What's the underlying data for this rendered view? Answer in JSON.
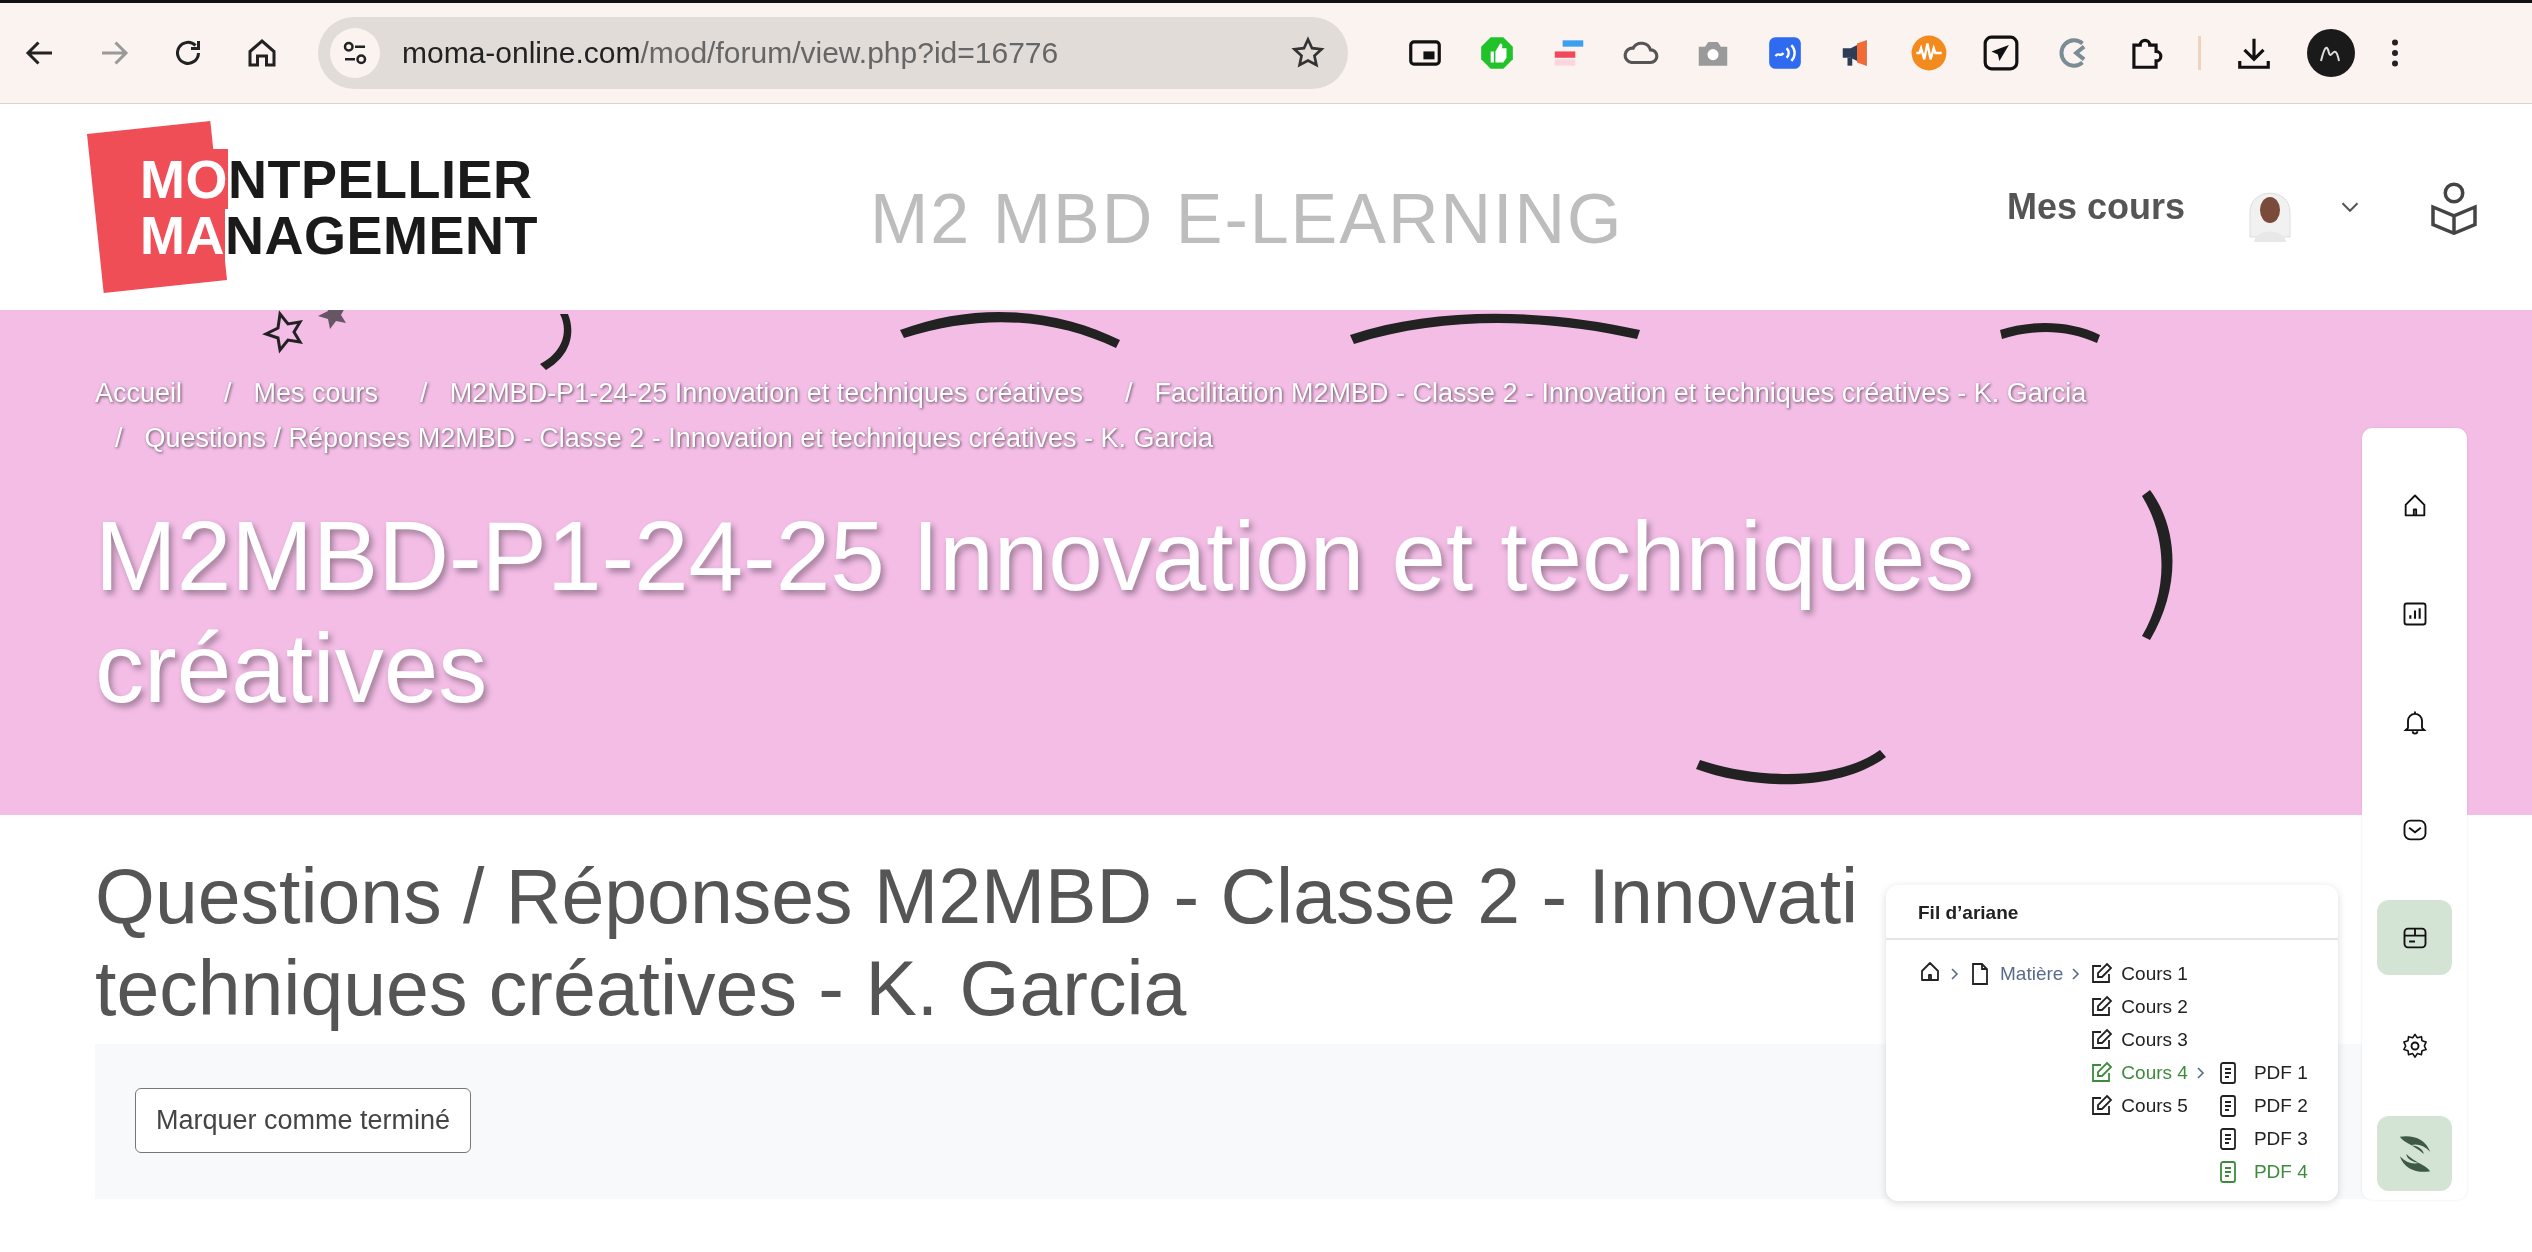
{
  "browser": {
    "url": {
      "domain": "moma-online.com",
      "path": "/mod/forum/view.php?id=16776"
    },
    "forward_disabled": true
  },
  "header": {
    "logo": [
      {
        "accent": "MO",
        "rest": "NTPELLIER"
      },
      {
        "accent": "MA",
        "rest": "NAGEMENT"
      }
    ],
    "site_name": "M2 MBD E-LEARNING",
    "nav_link": "Mes cours"
  },
  "banner": {
    "separator": "/",
    "breadcrumb": [
      "Accueil",
      "Mes cours",
      "M2MBD-P1-24-25 Innovation et techniques créatives",
      "Facilitation M2MBD - Classe 2 - Innovation et techniques créatives - K. Garcia",
      "Questions / Réponses M2MBD - Classe 2 - Innovation et techniques créatives - K. Garcia"
    ],
    "title": "M2MBD-P1-24-25 Innovation et techniques créatives"
  },
  "page": {
    "heading_lines": [
      "Questions / Réponses M2MBD - Classe 2 - Innovati",
      "techniques créatives - K. Garcia"
    ],
    "complete_button": "Marquer comme terminé"
  },
  "drawer": {
    "items": [
      {
        "kind": "home",
        "selected": false
      },
      {
        "kind": "chart",
        "selected": false
      },
      {
        "kind": "bell",
        "selected": false
      },
      {
        "kind": "mail",
        "selected": false
      },
      {
        "kind": "box",
        "selected": true
      },
      {
        "kind": "gear",
        "selected": false
      },
      {
        "kind": "brand"
      }
    ]
  },
  "breadcrumb_popup": {
    "title": "Fil d’ariane",
    "tree": {
      "label": "Matière",
      "children": [
        {
          "label": "Cours 1",
          "selected": false
        },
        {
          "label": "Cours 2",
          "selected": false
        },
        {
          "label": "Cours 3",
          "selected": false
        },
        {
          "label": "Cours 4",
          "selected": true,
          "children": [
            {
              "label": "PDF 1",
              "selected": false
            },
            {
              "label": "PDF 2",
              "selected": false
            },
            {
              "label": "PDF 3",
              "selected": false
            },
            {
              "label": "PDF 4",
              "selected": true
            }
          ]
        },
        {
          "label": "Cours 5",
          "selected": false
        }
      ]
    }
  }
}
